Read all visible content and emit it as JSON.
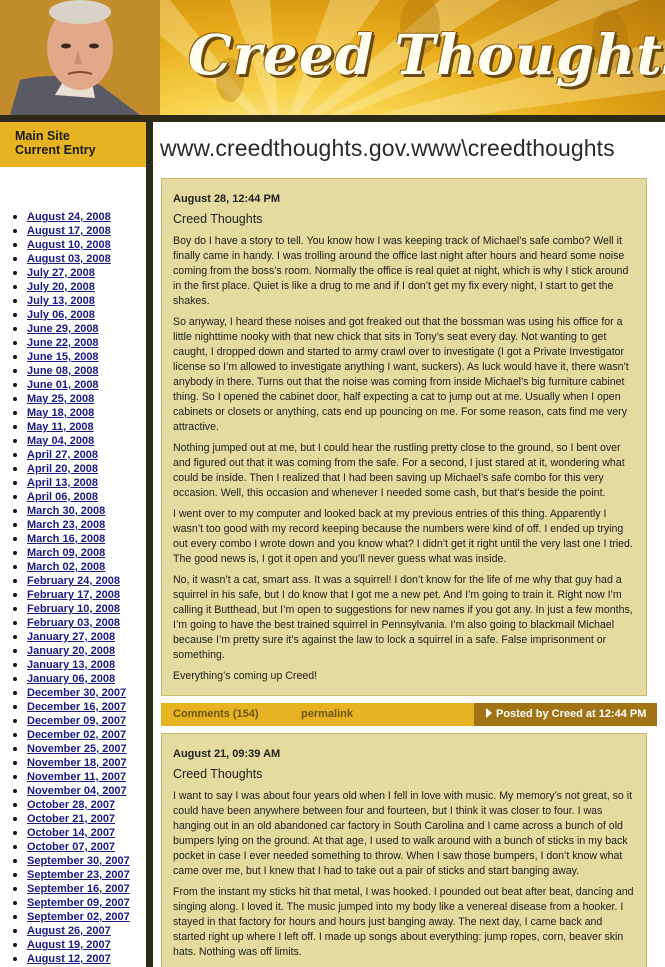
{
  "header": {
    "site_title": "Creed Thoughts",
    "colors": {
      "gold": "#e8b323",
      "dark_gold": "#a07414",
      "post_bg": "#e3dba0"
    }
  },
  "sidebar": {
    "nav": [
      "Main Site",
      "Current Entry"
    ],
    "archive": [
      "August 24, 2008",
      "August 17, 2008",
      "August 10, 2008",
      "August 03, 2008",
      "July 27, 2008",
      "July 20, 2008",
      "July 13, 2008",
      "July 06, 2008",
      "June 29, 2008",
      "June 22, 2008",
      "June 15, 2008",
      "June 08, 2008",
      "June 01, 2008",
      "May 25, 2008",
      "May 18, 2008",
      "May 11, 2008",
      "May 04, 2008",
      "April 27, 2008",
      "April 20, 2008",
      "April 13, 2008",
      "April 06, 2008",
      "March 30, 2008",
      "March 23, 2008",
      "March 16, 2008",
      "March 09, 2008",
      "March 02, 2008",
      "February 24, 2008",
      "February 17, 2008",
      "February 10, 2008",
      "February 03, 2008",
      "January 27, 2008",
      "January 20, 2008",
      "January 13, 2008",
      "January 06, 2008",
      "December 30, 2007",
      "December 16, 2007",
      "December 09, 2007",
      "December 02, 2007",
      "November 25, 2007",
      "November 18, 2007",
      "November 11, 2007",
      "November 04, 2007",
      "October 28, 2007",
      "October 21, 2007",
      "October 14, 2007",
      "October 07, 2007",
      "September 30, 2007",
      "September 23, 2007",
      "September 16, 2007",
      "September 09, 2007",
      "September 02, 2007",
      "August 26, 2007",
      "August 19, 2007",
      "August 12, 2007"
    ]
  },
  "main": {
    "url_title": "www.creedthoughts.gov.www\\creedthoughts",
    "posts": [
      {
        "date": "August 28, 12:44 PM",
        "title": "Creed Thoughts",
        "paragraphs": [
          "Boy do I have a story to tell. You know how I was keeping track of Michael’s safe combo? Well it finally came in handy. I was trolling around the office last night after hours and heard some noise coming from the boss’s room. Normally the office is real quiet at night, which is why I stick around in the first place. Quiet is like a drug to me and if I don’t get my fix every night, I start to get the shakes.",
          "So anyway, I heard these noises and got freaked out that the bossman was using his office for a little nighttime nooky with that new chick that sits in Tony’s seat every day. Not wanting to get caught, I dropped down and started to army crawl over to investigate (I got a Private Investigator license so I’m allowed to investigate anything I want, suckers). As luck would have it, there wasn’t anybody in there. Turns out that the noise was coming from inside Michael’s big furniture cabinet thing. So I opened the cabinet door, half expecting a cat to jump out at me. Usually when I open cabinets or closets or anything, cats end up pouncing on me. For some reason, cats find me very attractive.",
          "Nothing jumped out at me, but I could hear the rustling pretty close to the ground, so I bent over and figured out that it was coming from the safe. For a second, I just stared at it, wondering what could be inside. Then I realized that I had been saving up Michael’s safe combo for this very occasion. Well, this occasion and whenever I needed some cash, but that’s beside the point.",
          "I went over to my computer and looked back at my previous entries of this thing. Apparently I wasn’t too good with my record keeping because the numbers were kind of off. I ended up trying out every combo I wrote down and you know what? I didn’t get it right until the very last one I tried. The good news is, I got it open and you’ll never guess what was inside.",
          "No, it wasn’t a cat, smart ass. It was a squirrel! I don’t know for the life of me why that guy had a squirrel in his safe, but I do know that I got me a new pet. And I’m going to train it. Right now I’m calling it Butthead, but I’m open to suggestions for new names if you got any. In just a few months, I’m going to have the best trained squirrel in Pennsylvania. I’m also going to blackmail Michael because I’m pretty sure it’s against the law to lock a squirrel in a safe. False imprisonment or something.",
          "Everything’s coming up Creed!"
        ],
        "comments": "Comments (154)",
        "permalink": "permalink",
        "posted_by": "Posted by Creed at 12:44 PM"
      },
      {
        "date": "August 21, 09:39 AM",
        "title": "Creed Thoughts",
        "paragraphs": [
          "I want to say I was about four years old when I fell in love with music. My memory’s not great, so it could have been anywhere between four and fourteen, but I think it was closer to four. I was hanging out in an old abandoned car factory in South Carolina and I came across a bunch of old bumpers lying on the ground. At that age, I used to walk around with a bunch of sticks in my back pocket in case I ever needed something to throw. When I saw those bumpers, I don’t know what came over me, but I knew that I had to take out a pair of sticks and start banging away.",
          "From the instant my sticks hit that metal, I was hooked. I pounded out beat after beat, dancing and singing along. I loved it. The music jumped into my body like a venereal disease from a hooker. I stayed in that factory for hours and hours just banging away. The next day, I came back and started right up where I left off. I made up songs about everything: jump ropes, corn, beaver skin hats. Nothing was off limits."
        ]
      }
    ]
  }
}
